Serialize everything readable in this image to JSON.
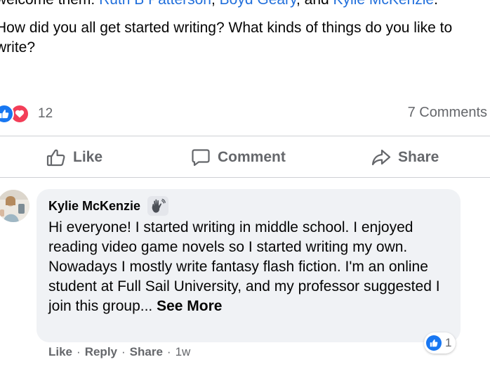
{
  "post": {
    "line1_prefix": "welcome them: ",
    "name1": "Ruth B Patterson",
    "sep1": ", ",
    "name2": "Boyd Geary",
    "sep2": ", and ",
    "name3": "Kylie McKenzie",
    "line1_suffix": ".",
    "paragraph2": "How did you all get started writing? What kinds of things do you like to write?"
  },
  "stats": {
    "reaction_count": "12",
    "comments_count": "7 Comments"
  },
  "actions": {
    "like": "Like",
    "comment": "Comment",
    "share": "Share"
  },
  "comment": {
    "author": "Kylie McKenzie",
    "text": "Hi everyone! I started writing in middle school. I enjoyed reading video game novels so I started writing my own. Nowadays I mostly write fantasy flash fiction. I'm an online student at Full Sail University, and my professor suggested I join this group... ",
    "see_more": "See More",
    "reaction_count": "1",
    "like": "Like",
    "reply": "Reply",
    "share": "Share",
    "time": "1w",
    "dot": "·"
  },
  "colors": {
    "link_blue": "#216fdb",
    "like_blue": "#1877f2",
    "love_red": "#f33e58",
    "secondary_text": "#65676b",
    "bubble_bg": "#f0f2f5"
  },
  "icons": {
    "reaction_like": "thumbs-up-icon",
    "reaction_love": "heart-icon",
    "action_like": "thumbs-up-outline-icon",
    "action_comment": "speech-bubble-icon",
    "action_share": "share-arrow-icon",
    "badge": "waving-hand-icon"
  }
}
